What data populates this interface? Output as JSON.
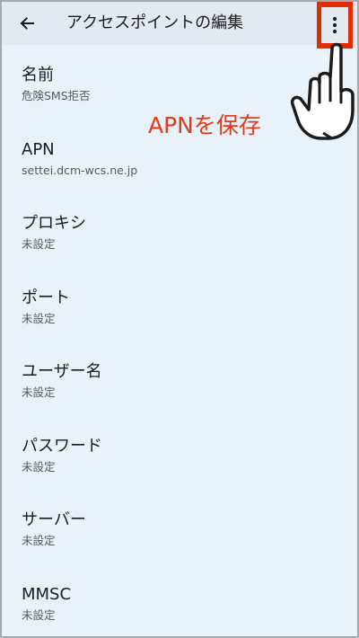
{
  "header": {
    "title": "アクセスポイントの編集",
    "back_icon": "arrow-left-icon",
    "menu_icon": "more-vert-icon"
  },
  "items": [
    {
      "title": "名前",
      "value": "危険SMS拒否"
    },
    {
      "title": "APN",
      "value": "settei.dcm-wcs.ne.jp"
    },
    {
      "title": "プロキシ",
      "value": "未設定"
    },
    {
      "title": "ポート",
      "value": "未設定"
    },
    {
      "title": "ユーザー名",
      "value": "未設定"
    },
    {
      "title": "パスワード",
      "value": "未設定"
    },
    {
      "title": "サーバー",
      "value": "未設定"
    },
    {
      "title": "MMSC",
      "value": "未設定"
    }
  ],
  "annotation": {
    "text": "APNを保存",
    "color": "#e03c1c",
    "pointer_icon": "hand-pointer-icon"
  },
  "colors": {
    "appbar": "#e2e9f0",
    "background": "#e9f2f8",
    "highlight": "#e32d00"
  }
}
